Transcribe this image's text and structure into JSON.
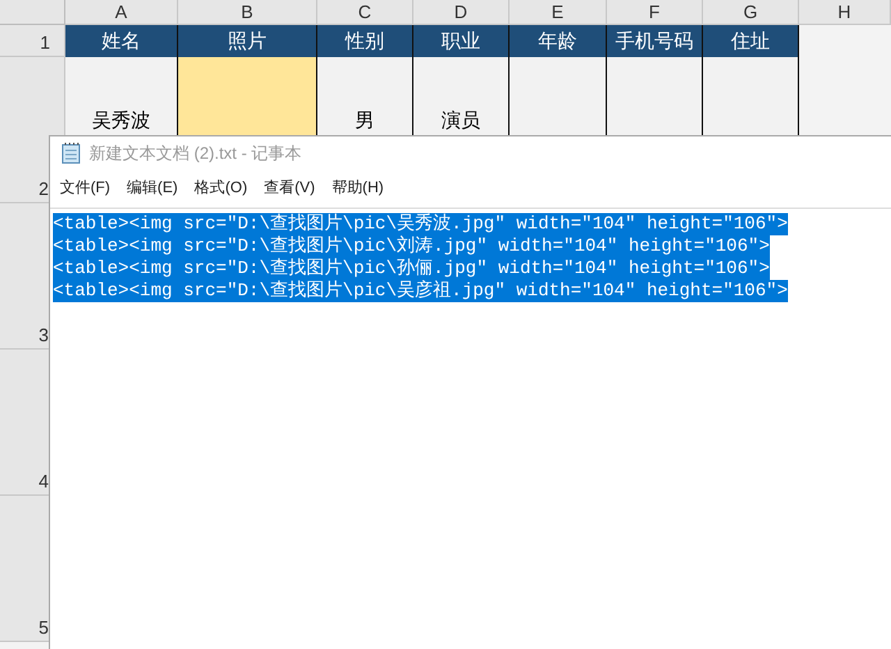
{
  "sheet": {
    "columns": [
      "A",
      "B",
      "C",
      "D",
      "E",
      "F",
      "G",
      "H"
    ],
    "row_numbers": [
      "1",
      "2",
      "3",
      "4",
      "5"
    ],
    "header_row": [
      "姓名",
      "照片",
      "性别",
      "职业",
      "年龄",
      "手机号码",
      "住址"
    ],
    "row_2": [
      {
        "text": "吴秀波",
        "selected": false
      },
      {
        "selected": true
      },
      {
        "text": "男",
        "selected": false
      },
      {
        "text": "演员",
        "selected": false
      },
      {
        "selected": false
      },
      {
        "selected": false
      },
      {
        "selected": false
      }
    ]
  },
  "notepad": {
    "title": "新建文本文档 (2).txt - 记事本",
    "menu": [
      "文件(F)",
      "编辑(E)",
      "格式(O)",
      "查看(V)",
      "帮助(H)"
    ],
    "lines": [
      {
        "text": "<table><img src=\"D:\\查找图片\\pic\\吴秀波.jpg\" width=\"104\" height=\"106\">",
        "selected": true
      },
      {
        "text": "<table><img src=\"D:\\查找图片\\pic\\刘涛.jpg\" width=\"104\" height=\"106\">",
        "selected": true
      },
      {
        "text": "<table><img src=\"D:\\查找图片\\pic\\孙俪.jpg\" width=\"104\" height=\"106\">",
        "selected": true
      },
      {
        "text": "<table><img src=\"D:\\查找图片\\pic\\吴彦祖.jpg\" width=\"104\" height=\"106\">",
        "selected": true
      }
    ]
  }
}
